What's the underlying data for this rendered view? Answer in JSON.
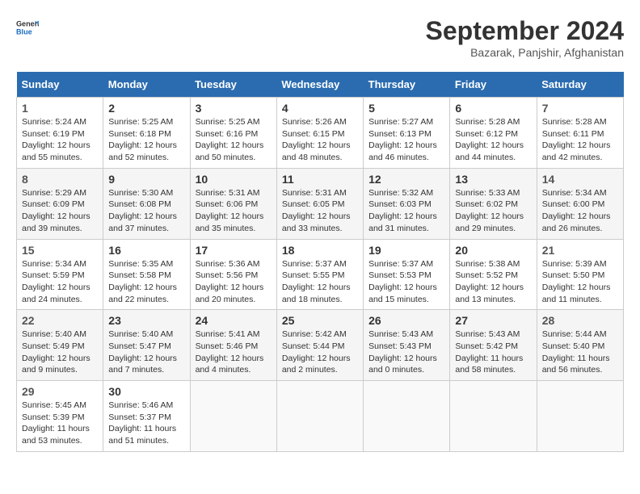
{
  "header": {
    "logo_line1": "General",
    "logo_line2": "Blue",
    "month": "September 2024",
    "location": "Bazarak, Panjshir, Afghanistan"
  },
  "weekdays": [
    "Sunday",
    "Monday",
    "Tuesday",
    "Wednesday",
    "Thursday",
    "Friday",
    "Saturday"
  ],
  "weeks": [
    [
      {
        "day": "1",
        "rise": "5:24 AM",
        "set": "6:19 PM",
        "hours": "12 hours",
        "mins": "55"
      },
      {
        "day": "2",
        "rise": "5:25 AM",
        "set": "6:18 PM",
        "hours": "12 hours",
        "mins": "52"
      },
      {
        "day": "3",
        "rise": "5:25 AM",
        "set": "6:16 PM",
        "hours": "12 hours",
        "mins": "50"
      },
      {
        "day": "4",
        "rise": "5:26 AM",
        "set": "6:15 PM",
        "hours": "12 hours",
        "mins": "48"
      },
      {
        "day": "5",
        "rise": "5:27 AM",
        "set": "6:13 PM",
        "hours": "12 hours",
        "mins": "46"
      },
      {
        "day": "6",
        "rise": "5:28 AM",
        "set": "6:12 PM",
        "hours": "12 hours",
        "mins": "44"
      },
      {
        "day": "7",
        "rise": "5:28 AM",
        "set": "6:11 PM",
        "hours": "12 hours",
        "mins": "42"
      }
    ],
    [
      {
        "day": "8",
        "rise": "5:29 AM",
        "set": "6:09 PM",
        "hours": "12 hours",
        "mins": "39"
      },
      {
        "day": "9",
        "rise": "5:30 AM",
        "set": "6:08 PM",
        "hours": "12 hours",
        "mins": "37"
      },
      {
        "day": "10",
        "rise": "5:31 AM",
        "set": "6:06 PM",
        "hours": "12 hours",
        "mins": "35"
      },
      {
        "day": "11",
        "rise": "5:31 AM",
        "set": "6:05 PM",
        "hours": "12 hours",
        "mins": "33"
      },
      {
        "day": "12",
        "rise": "5:32 AM",
        "set": "6:03 PM",
        "hours": "12 hours",
        "mins": "31"
      },
      {
        "day": "13",
        "rise": "5:33 AM",
        "set": "6:02 PM",
        "hours": "12 hours",
        "mins": "29"
      },
      {
        "day": "14",
        "rise": "5:34 AM",
        "set": "6:00 PM",
        "hours": "12 hours",
        "mins": "26"
      }
    ],
    [
      {
        "day": "15",
        "rise": "5:34 AM",
        "set": "5:59 PM",
        "hours": "12 hours",
        "mins": "24"
      },
      {
        "day": "16",
        "rise": "5:35 AM",
        "set": "5:58 PM",
        "hours": "12 hours",
        "mins": "22"
      },
      {
        "day": "17",
        "rise": "5:36 AM",
        "set": "5:56 PM",
        "hours": "12 hours",
        "mins": "20"
      },
      {
        "day": "18",
        "rise": "5:37 AM",
        "set": "5:55 PM",
        "hours": "12 hours",
        "mins": "18"
      },
      {
        "day": "19",
        "rise": "5:37 AM",
        "set": "5:53 PM",
        "hours": "12 hours",
        "mins": "15"
      },
      {
        "day": "20",
        "rise": "5:38 AM",
        "set": "5:52 PM",
        "hours": "12 hours",
        "mins": "13"
      },
      {
        "day": "21",
        "rise": "5:39 AM",
        "set": "5:50 PM",
        "hours": "12 hours",
        "mins": "11"
      }
    ],
    [
      {
        "day": "22",
        "rise": "5:40 AM",
        "set": "5:49 PM",
        "hours": "12 hours",
        "mins": "9"
      },
      {
        "day": "23",
        "rise": "5:40 AM",
        "set": "5:47 PM",
        "hours": "12 hours",
        "mins": "7"
      },
      {
        "day": "24",
        "rise": "5:41 AM",
        "set": "5:46 PM",
        "hours": "12 hours",
        "mins": "4"
      },
      {
        "day": "25",
        "rise": "5:42 AM",
        "set": "5:44 PM",
        "hours": "12 hours",
        "mins": "2"
      },
      {
        "day": "26",
        "rise": "5:43 AM",
        "set": "5:43 PM",
        "hours": "12 hours",
        "mins": "0"
      },
      {
        "day": "27",
        "rise": "5:43 AM",
        "set": "5:42 PM",
        "hours": "11 hours",
        "mins": "58"
      },
      {
        "day": "28",
        "rise": "5:44 AM",
        "set": "5:40 PM",
        "hours": "11 hours",
        "mins": "56"
      }
    ],
    [
      {
        "day": "29",
        "rise": "5:45 AM",
        "set": "5:39 PM",
        "hours": "11 hours",
        "mins": "53"
      },
      {
        "day": "30",
        "rise": "5:46 AM",
        "set": "5:37 PM",
        "hours": "11 hours",
        "mins": "51"
      },
      null,
      null,
      null,
      null,
      null
    ]
  ]
}
